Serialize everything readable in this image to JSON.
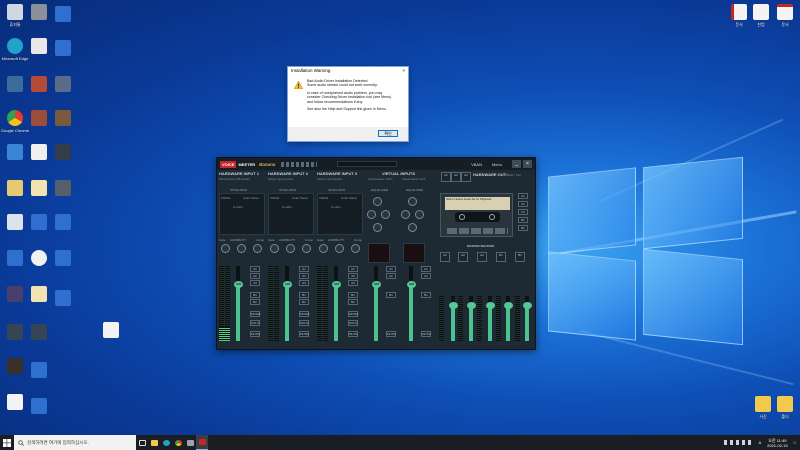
{
  "desktop": {
    "right_icons": [
      {
        "label": "문서"
      },
      {
        "label": "한컴"
      },
      {
        "label": "문서"
      }
    ],
    "bottom_right_icons": [
      {
        "label": "사진"
      },
      {
        "label": "폴더"
      }
    ],
    "left_icon_labels": [
      "휴지통",
      "내 PC",
      "Microsoft Edge",
      "Google Chrome",
      "보이스미터",
      "카카오톡",
      "한컴오피스",
      "네트워크"
    ]
  },
  "dialog": {
    "title": "Installation Warning",
    "close_glyph": "×",
    "line1": "Bad Audio Driver Installation Detected",
    "line2": "Some audio stream could not work correctly.",
    "line3": "In case of unexplained audio problem, you may",
    "line4": "consider Checking Driver Installation tool (see Menu)",
    "line5": "and follow recommendations if any.",
    "line6": "See also the Help and Support link given in Menu.",
    "ok_label": "확인",
    "warning_color": "#f2c02a"
  },
  "voicemeeter": {
    "logo_part1": "VOICE",
    "logo_part2": "MEETER",
    "logo_part3": "Banana",
    "vban": "VBAN",
    "menu": "Menu",
    "minimize": "_",
    "close": "×",
    "strips": [
      {
        "title": "HARDWARE INPUT 1",
        "device": "Microphone (VB-Audio)",
        "intellipan": "INTELLIPAN",
        "color_panel": "Color Panel",
        "voice": "VOICE",
        "fx_echo": "fx echo",
        "audibility": "AUDIBILITY",
        "gate": "Gate",
        "comp": "Comp"
      },
      {
        "title": "HARDWARE INPUT 2",
        "device": "Select input device",
        "intellipan": "INTELLIPAN",
        "color_panel": "Color Panel",
        "voice": "VOICE",
        "fx_echo": "fx echo",
        "audibility": "AUDIBILITY",
        "gate": "Gate",
        "comp": "Comp"
      },
      {
        "title": "HARDWARE INPUT 3",
        "device": "Select input device",
        "intellipan": "INTELLIPAN",
        "color_panel": "Color Panel",
        "voice": "VOICE",
        "fx_echo": "fx echo",
        "audibility": "AUDIBILITY",
        "gate": "Gate",
        "comp": "Comp"
      }
    ],
    "virtual_inputs": {
      "title": "VIRTUAL INPUTS",
      "v1": "Voicemeeter VAIO",
      "v2": "Voicemeeter AUX",
      "equalizer": "EQUALIZER"
    },
    "hardware_out": {
      "title": "HARDWARE OUT",
      "rate": "48kHz | 512",
      "a1": "A1",
      "a2": "A2",
      "a3": "A3"
    },
    "cassette_label": "click to Select Audio file for Playback",
    "master_section": "MASTER SECTION",
    "bus_labels": [
      "A1",
      "A2",
      "A3",
      "B1",
      "B2"
    ],
    "mute": "MUTE",
    "solo": "SOLO",
    "mono": "MONO",
    "fader_labels": [
      "0dB",
      "0dB",
      "0dB",
      "0dB",
      "0dB"
    ]
  },
  "taskbar": {
    "search_placeholder": "검색하려면 여기에 입력하십시오.",
    "time": "오전 11:49",
    "date": "2021-02-19",
    "lang": "A",
    "notify": "□"
  }
}
